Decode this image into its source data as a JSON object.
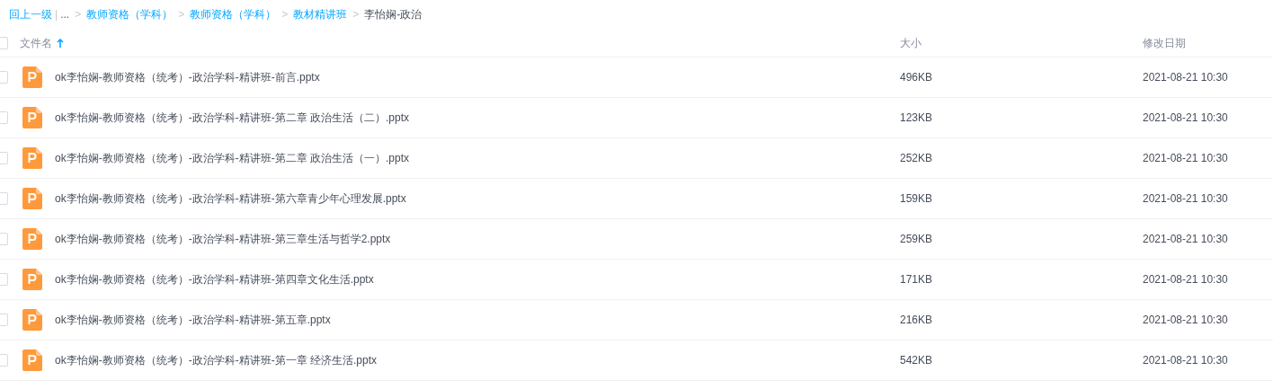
{
  "breadcrumb": {
    "back": "回上一级",
    "separator": "|",
    "ellipsis": "...",
    "chevron": ">",
    "links": [
      "教师资格（学科）",
      "教师资格（学科）",
      "教材精讲班"
    ],
    "current": "李怡娴-政治"
  },
  "table": {
    "select_all": {
      "checked": false
    },
    "columns": [
      {
        "label": "文件名",
        "sorted": true
      },
      {
        "label": "大小",
        "sorted": false
      },
      {
        "label": "修改日期",
        "sorted": false
      }
    ],
    "rows": [
      {
        "checked": false,
        "name": "ok李怡娴-教师资格（统考）-政治学科-精讲班-前言.pptx",
        "size": "496KB",
        "date": "2021-08-21 10:30"
      },
      {
        "checked": false,
        "name": "ok李怡娴-教师资格（统考）-政治学科-精讲班-第二章 政治生活（二）.pptx",
        "size": "123KB",
        "date": "2021-08-21 10:30"
      },
      {
        "checked": false,
        "name": "ok李怡娴-教师资格（统考）-政治学科-精讲班-第二章 政治生活（一）.pptx",
        "size": "252KB",
        "date": "2021-08-21 10:30"
      },
      {
        "checked": false,
        "name": "ok李怡娴-教师资格（统考）-政治学科-精讲班-第六章青少年心理发展.pptx",
        "size": "159KB",
        "date": "2021-08-21 10:30"
      },
      {
        "checked": false,
        "name": "ok李怡娴-教师资格（统考）-政治学科-精讲班-第三章生活与哲学2.pptx",
        "size": "259KB",
        "date": "2021-08-21 10:30"
      },
      {
        "checked": false,
        "name": "ok李怡娴-教师资格（统考）-政治学科-精讲班-第四章文化生活.pptx",
        "size": "171KB",
        "date": "2021-08-21 10:30"
      },
      {
        "checked": false,
        "name": "ok李怡娴-教师资格（统考）-政治学科-精讲班-第五章.pptx",
        "size": "216KB",
        "date": "2021-08-21 10:30"
      },
      {
        "checked": false,
        "name": "ok李怡娴-教师资格（统考）-政治学科-精讲班-第一章 经济生活.pptx",
        "size": "542KB",
        "date": "2021-08-21 10:30"
      }
    ]
  }
}
